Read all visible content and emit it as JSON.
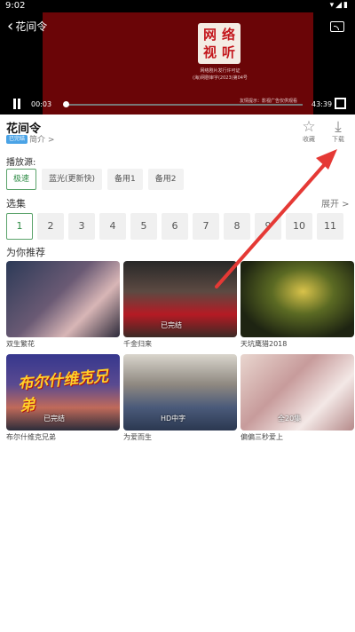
{
  "status_bar": {
    "time": "9:02",
    "icons": "▾◢▮"
  },
  "player": {
    "back_title": "花间令",
    "seal_chars": [
      "网",
      "络",
      "视",
      "听"
    ],
    "license_line1": "网络剧片发行许可证",
    "license_line2": "(海)网剧审字(2023)第04号",
    "notice": "友情提示：影视广告仅供观看",
    "current_time": "00:03",
    "total_time": "43:39",
    "progress_fraction": 0.001
  },
  "info": {
    "title": "花间令",
    "tag": "已完结",
    "intro_label": "简介 >",
    "favorite_icon": "☆",
    "favorite_label": "收藏",
    "download_icon": "⤓",
    "download_label": "下载"
  },
  "sources": {
    "heading": "播放源:",
    "items": [
      "极速",
      "蓝光(更新快)",
      "备用1",
      "备用2"
    ],
    "selected_index": 0
  },
  "episodes": {
    "heading": "选集",
    "expand_label": "展开 >",
    "items": [
      "1",
      "2",
      "3",
      "4",
      "5",
      "6",
      "7",
      "8",
      "9",
      "10",
      "11"
    ],
    "selected_index": 0
  },
  "recommendations": {
    "heading": "为你推荐",
    "items": [
      {
        "name": "双生繁花",
        "badge": ""
      },
      {
        "name": "千金归来",
        "badge": "已完结"
      },
      {
        "name": "天坑鹰猎2018",
        "badge": ""
      },
      {
        "name": "布尔什维克兄弟",
        "badge": "已完结",
        "poster_text": "布尔什维克兄弟"
      },
      {
        "name": "为爱而生",
        "badge": "HD中字"
      },
      {
        "name": "偏偏三秒爱上",
        "badge": "全20集"
      }
    ]
  },
  "colors": {
    "accent_green": "#2e8b45",
    "annotation_red": "#e53935",
    "video_bg": "#6a0507"
  }
}
